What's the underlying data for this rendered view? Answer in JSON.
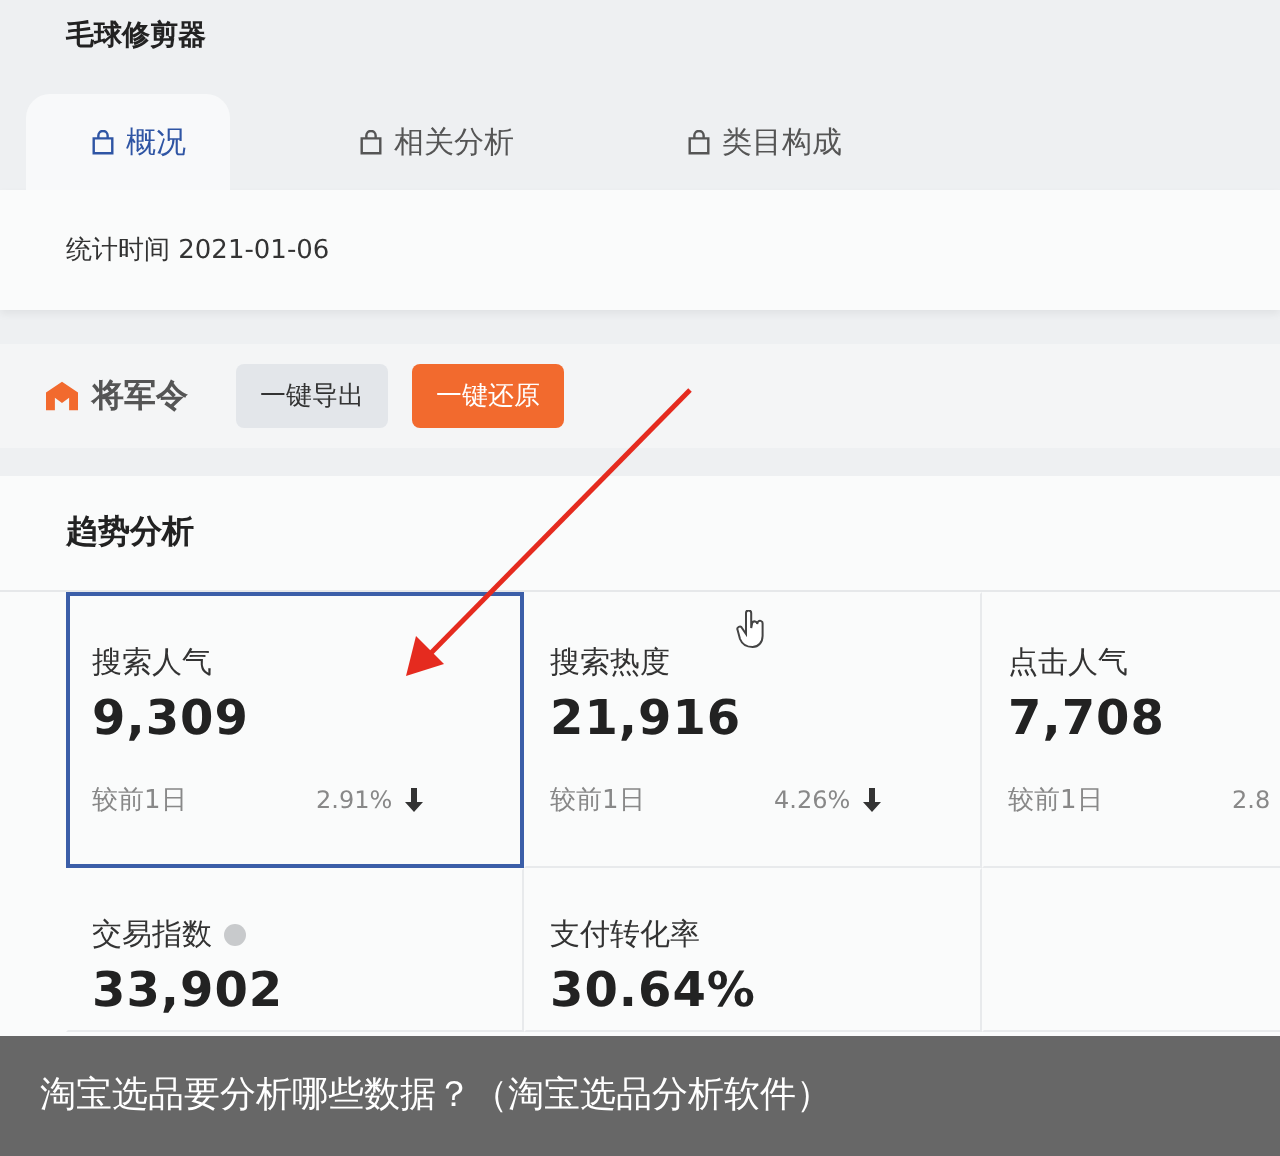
{
  "product_title": "毛球修剪器",
  "tabs": [
    {
      "label": "概况",
      "selected": true
    },
    {
      "label": "相关分析",
      "selected": false
    },
    {
      "label": "类目构成",
      "selected": false
    }
  ],
  "stat_date": "统计时间 2021-01-06",
  "toolbar": {
    "brand": "将军令",
    "buttons": [
      {
        "label": "一键导出",
        "kind": "secondary"
      },
      {
        "label": "一键还原",
        "kind": "primary"
      }
    ]
  },
  "trend": {
    "title": "趋势分析",
    "cards": [
      {
        "label": "搜索人气",
        "value": "9,309",
        "compare_label": "较前1日",
        "change": "2.91%",
        "falling": true,
        "info": false,
        "selected": true
      },
      {
        "label": "搜索热度",
        "value": "21,916",
        "compare_label": "较前1日",
        "change": "4.26%",
        "falling": true,
        "info": false,
        "selected": false
      },
      {
        "label": "点击人气",
        "value": "7,708",
        "compare_label": "较前1日",
        "change": "2.8",
        "info": false,
        "selected": false
      },
      {
        "label": "交易指数",
        "value": "33,902",
        "info": true,
        "selected": false
      },
      {
        "label": "支付转化率",
        "value": "30.64%",
        "info": false,
        "selected": false
      }
    ]
  },
  "caption": "淘宝选品要分析哪些数据？（淘宝选品分析软件）"
}
